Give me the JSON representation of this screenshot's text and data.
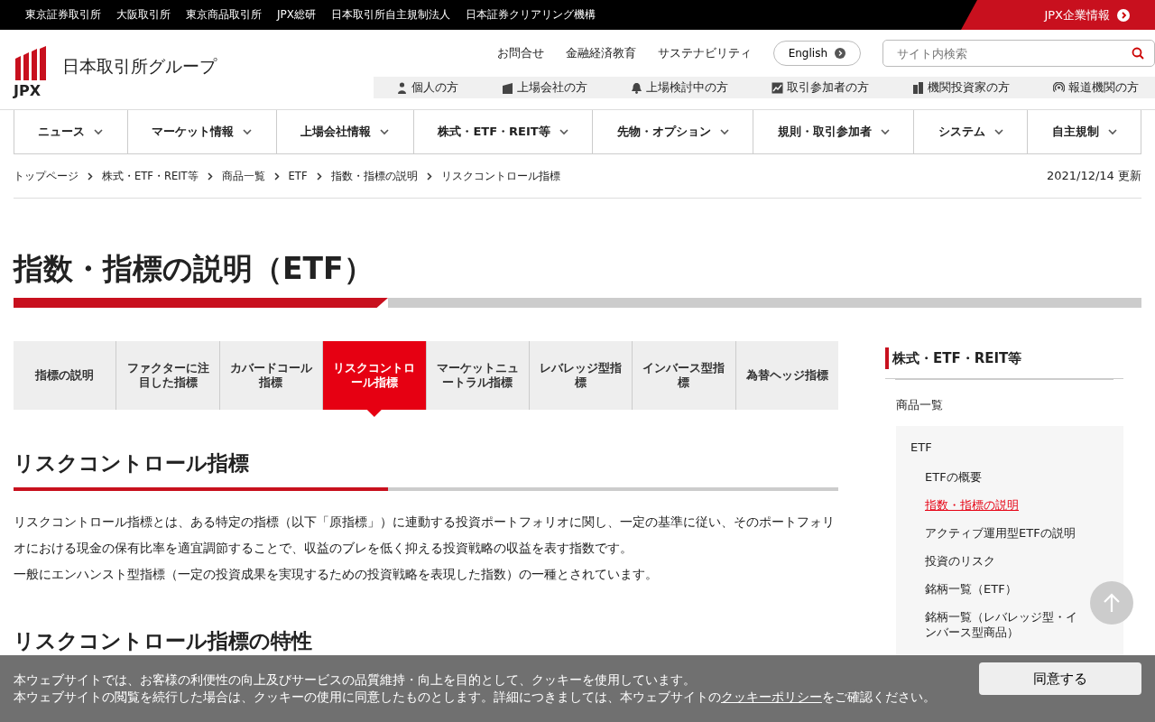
{
  "top_bar": {
    "links": [
      "東京証券取引所",
      "大阪取引所",
      "東京商品取引所",
      "JPX総研",
      "日本取引所自主規制法人",
      "日本証券クリアリング機構"
    ],
    "corporate_link": "JPX企業情報"
  },
  "header": {
    "logo_text": "JPX",
    "site_name": "日本取引所グループ",
    "utility_links": [
      "お問合せ",
      "金融経済教育",
      "サステナビリティ"
    ],
    "language_button": "English",
    "search": {
      "placeholder": "サイト内検索"
    },
    "audience_links": [
      {
        "kind": "person",
        "label": "個人の方"
      },
      {
        "kind": "building",
        "label": "上場会社の方"
      },
      {
        "kind": "bell",
        "label": "上場検討中の方"
      },
      {
        "kind": "chart",
        "label": "取引参加者の方"
      },
      {
        "kind": "office",
        "label": "機関投資家の方"
      },
      {
        "kind": "broadcast",
        "label": "報道機関の方"
      }
    ]
  },
  "main_nav": [
    "ニュース",
    "マーケット情報",
    "上場会社情報",
    "株式・ETF・REIT等",
    "先物・オプション",
    "規則・取引参加者",
    "システム",
    "自主規制"
  ],
  "breadcrumb": [
    "トップページ",
    "株式・ETF・REIT等",
    "商品一覧",
    "ETF",
    "指数・指標の説明",
    "リスクコントロール指標"
  ],
  "updated": "2021/12/14 更新",
  "page_title": "指数・指標の説明（ETF）",
  "tabs": [
    {
      "label": "指標の説明",
      "selected": false
    },
    {
      "label": "ファクターに注目した指標",
      "selected": false
    },
    {
      "label": "カバードコール指標",
      "selected": false
    },
    {
      "label": "リスクコントロール指標",
      "selected": true
    },
    {
      "label": "マーケットニュートラル指標",
      "selected": false
    },
    {
      "label": "レバレッジ型指標",
      "selected": false
    },
    {
      "label": "インバース型指標",
      "selected": false
    },
    {
      "label": "為替ヘッジ指標",
      "selected": false
    }
  ],
  "sections": [
    {
      "heading": "リスクコントロール指標",
      "paragraphs": [
        "リスクコントロール指標とは、ある特定の指標（以下「原指標」）に連動する投資ポートフォリオに関し、一定の基準に従い、そのポートフォリオにおける現金の保有比率を適宜調節することで、収益のブレを低く抑える投資戦略の収益を表す指数です。",
        "一般にエンハンスト型指標（一定の投資成果を実現するための投資戦略を表現した指数）の一種とされています。"
      ]
    },
    {
      "heading": "リスクコントロール指標の特性"
    }
  ],
  "sidebar": {
    "title": "株式・ETF・REIT等",
    "group": "商品一覧",
    "subgroup": "ETF",
    "items": [
      {
        "label": "ETFの概要",
        "selected": false
      },
      {
        "label": "指数・指標の説明",
        "selected": true
      },
      {
        "label": "アクティブ運用型ETFの説明",
        "selected": false
      },
      {
        "label": "投資のリスク",
        "selected": false
      },
      {
        "label": "銘柄一覧（ETF）",
        "selected": false
      },
      {
        "label": "銘柄一覧（レバレッジ型・インバース型商品）",
        "selected": false
      }
    ]
  },
  "cookie_banner": {
    "line_1": "本ウェブサイトでは、お客様の利便性の向上及びサービスの品質維持・向上を目的として、クッキーを使用しています。",
    "line_2_before": "本ウェブサイトの閲覧を続行した場合は、クッキーの使用に同意したものとします。詳細につきましては、本ウェブサイトの",
    "link": "クッキーポリシー",
    "line_2_after": "をご確認ください。",
    "button": "同意する"
  }
}
